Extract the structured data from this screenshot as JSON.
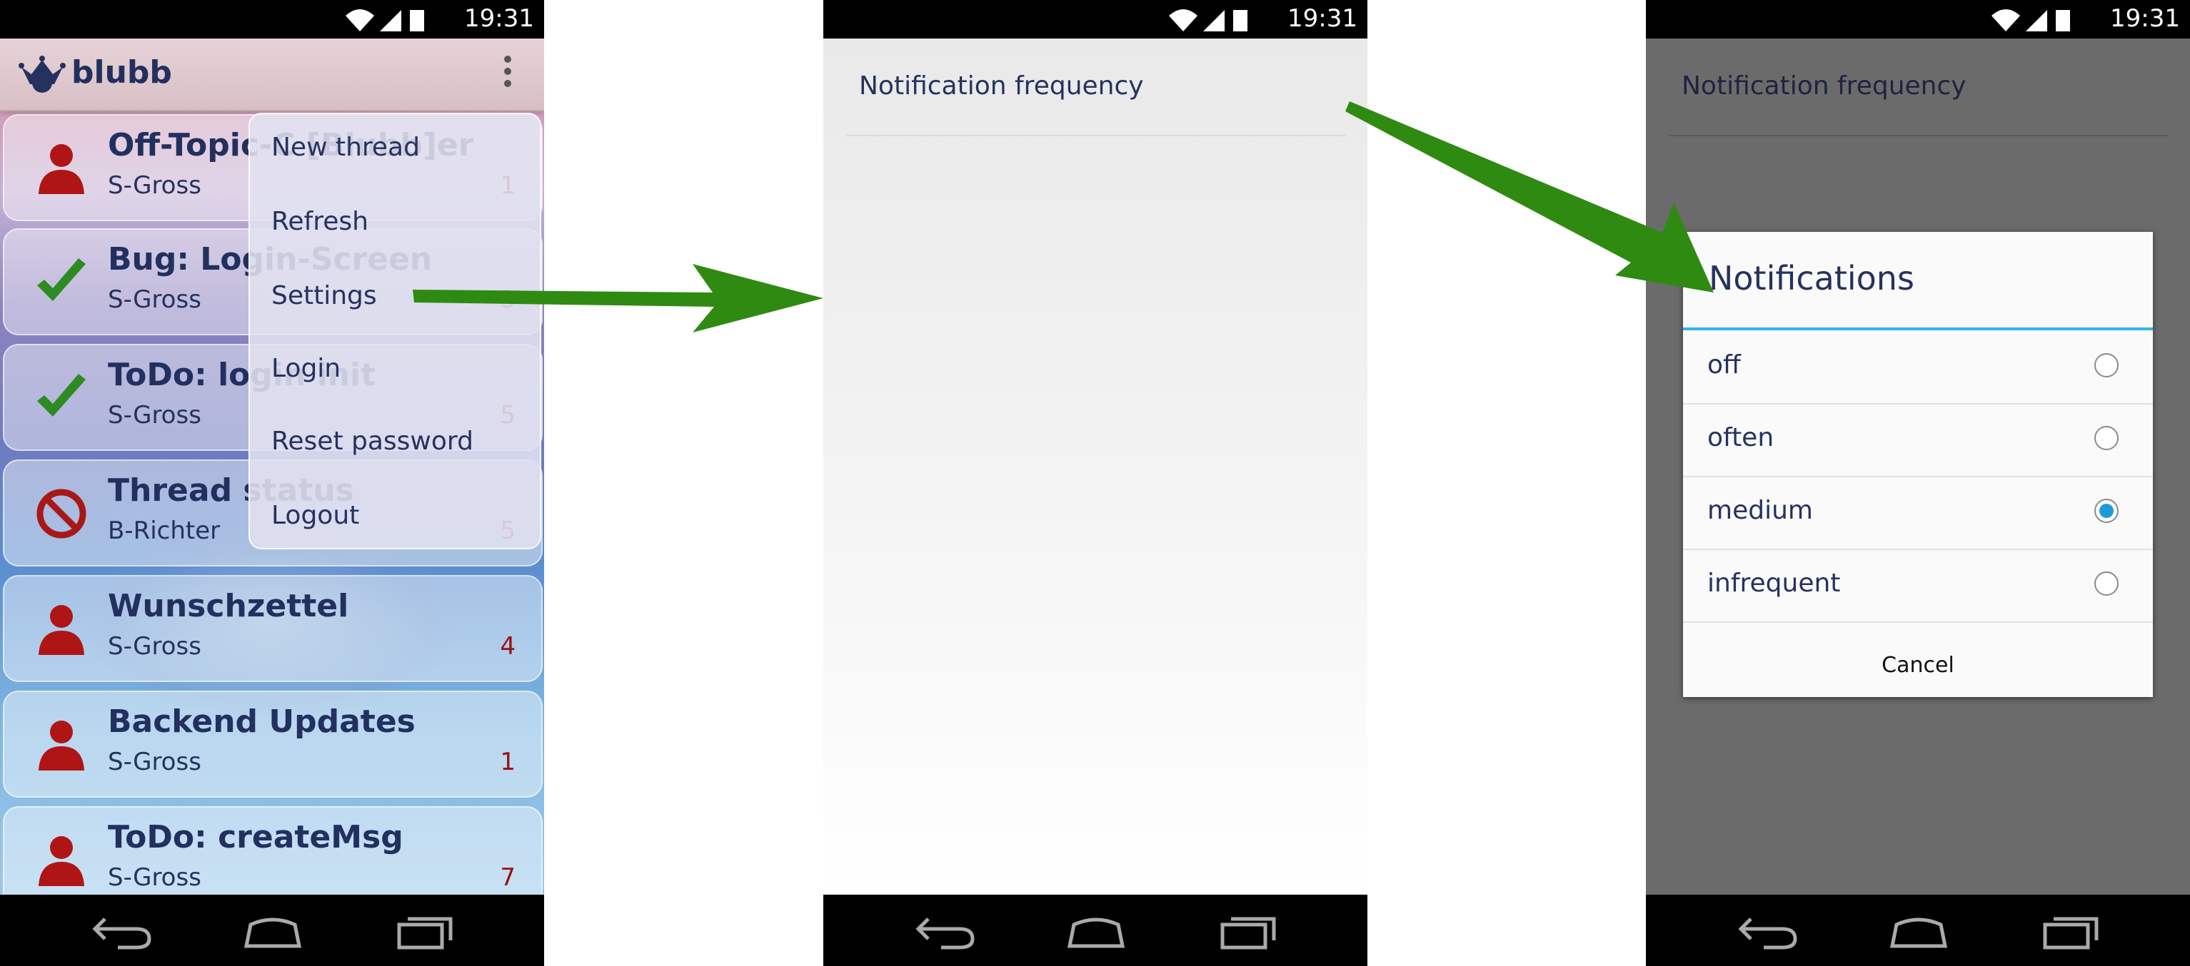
{
  "status_bar": {
    "time": "19:31"
  },
  "screen1": {
    "app_name": "blubb",
    "threads": [
      {
        "title": "Off-Topic-C [Blubb]er",
        "author": "S-Gross",
        "count": "1",
        "icon": "person-icon"
      },
      {
        "title": "Bug: Login-Screen",
        "author": "S-Gross",
        "count": "3",
        "icon": "checkmark-icon"
      },
      {
        "title": "ToDo: login init",
        "author": "S-Gross",
        "count": "5",
        "icon": "checkmark-icon"
      },
      {
        "title": "Thread status",
        "author": "B-Richter",
        "count": "5",
        "icon": "blocked-icon"
      },
      {
        "title": "Wunschzettel",
        "author": "S-Gross",
        "count": "4",
        "icon": "person-icon"
      },
      {
        "title": "Backend Updates",
        "author": "S-Gross",
        "count": "1",
        "icon": "person-icon"
      },
      {
        "title": "ToDo: createMsg",
        "author": "S-Gross",
        "count": "7",
        "icon": "person-icon"
      }
    ],
    "menu": [
      "New thread",
      "Refresh",
      "Settings",
      "Login",
      "Reset password",
      "Logout"
    ]
  },
  "screen2": {
    "preference": "Notification frequency"
  },
  "screen3": {
    "preference": "Notification frequency",
    "dialog_title": "Notifications",
    "options": [
      "off",
      "often",
      "medium",
      "infrequent"
    ],
    "selected": "medium",
    "cancel": "Cancel"
  },
  "colors": {
    "accent": "#33b5e5",
    "arrow": "#2f8a12",
    "text": "#26325e",
    "count": "#9a1010"
  }
}
